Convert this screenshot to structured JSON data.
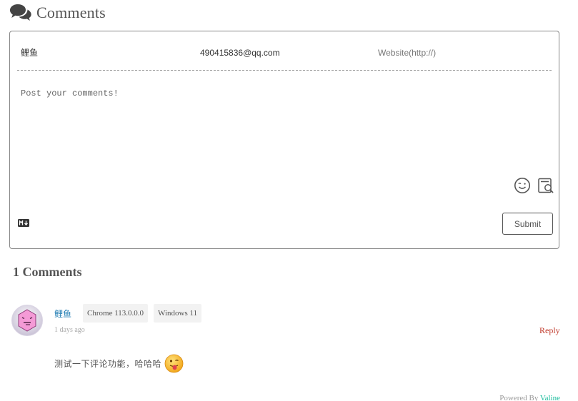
{
  "header": {
    "title": "Comments",
    "icon": "comments-icon"
  },
  "form": {
    "nick_value": "鲤鱼",
    "mail_value": "490415836@qq.com",
    "link_placeholder": "Website(http://)",
    "textarea_placeholder": "Post your comments!",
    "tools": [
      "emoji-icon",
      "preview-icon"
    ],
    "markdown_icon": "markdown-icon",
    "submit_label": "Submit"
  },
  "list": {
    "count_label": "1 Comments",
    "items": [
      {
        "nick": "鲤鱼",
        "browser": "Chrome 113.0.0.0",
        "os": "Windows 11",
        "time": "1 days ago",
        "reply_label": "Reply",
        "content": "测试一下评论功能，哈哈哈",
        "emoji": "tongue-emoji"
      }
    ]
  },
  "footer": {
    "powered_by": "Powered By",
    "brand": "Valine"
  },
  "colors": {
    "border": "#888888",
    "nick_link": "#2780b5",
    "reply": "#c0392b",
    "brand": "#1abc9c"
  }
}
